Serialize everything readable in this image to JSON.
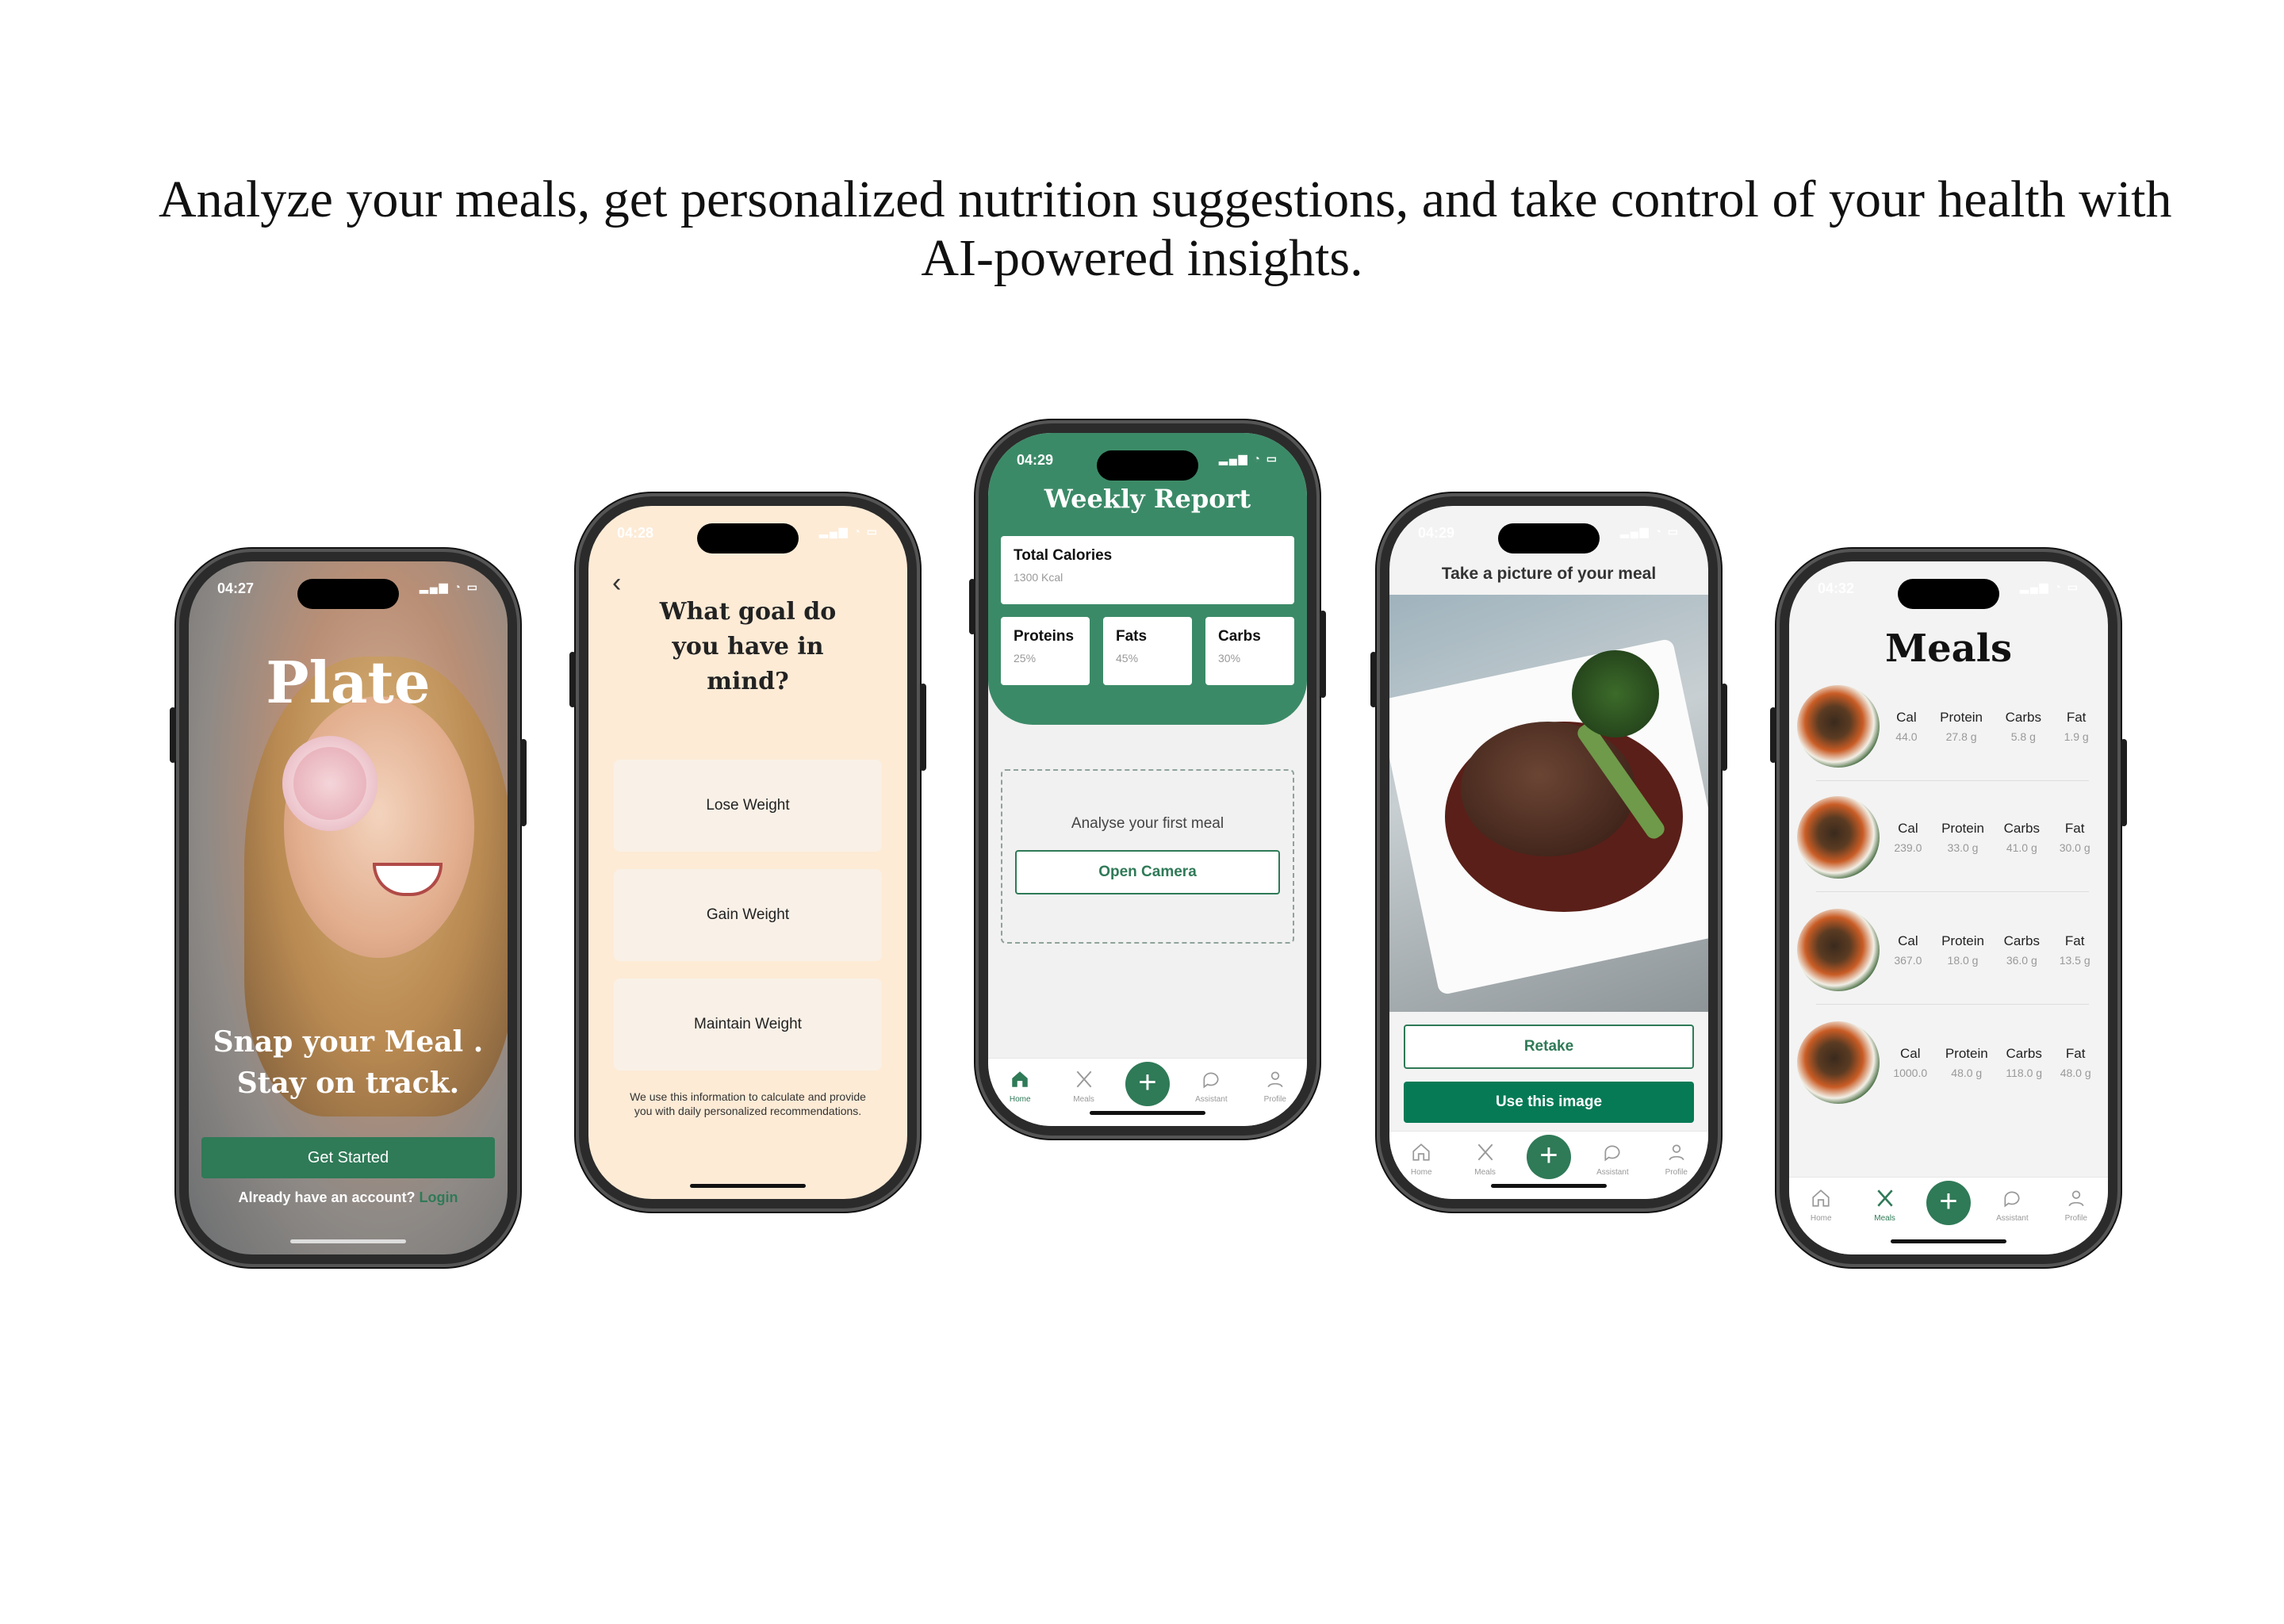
{
  "headline": {
    "line1": "Analyze your meals, get personalized nutrition suggestions, and take control of your health with",
    "line2": "AI-powered insights."
  },
  "accent_color": "#2f7a57",
  "tab_bar": {
    "home": "Home",
    "meals": "Meals",
    "assistant": "Assistant",
    "profile": "Profile",
    "add": "+"
  },
  "screen_welcome": {
    "time": "04:27",
    "app_name": "Plate",
    "tagline_line1": "Snap your Meal .",
    "tagline_line2": "Stay on track.",
    "cta": "Get Started",
    "login_prompt": "Already have an account?",
    "login_link": "Login"
  },
  "screen_goal": {
    "time": "04:28",
    "question_line1": "What goal do",
    "question_line2": "you have in",
    "question_line3": "mind?",
    "options": [
      "Lose Weight",
      "Gain Weight",
      "Maintain Weight"
    ],
    "note": "We use this information to calculate and provide you with daily personalized recommendations."
  },
  "screen_report": {
    "time": "04:29",
    "title": "Weekly Report",
    "total_calories_label": "Total Calories",
    "total_calories_value": "1300 Kcal",
    "macros": [
      {
        "label": "Proteins",
        "value": "25%"
      },
      {
        "label": "Fats",
        "value": "45%"
      },
      {
        "label": "Carbs",
        "value": "30%"
      }
    ],
    "analyse_prompt": "Analyse your first meal",
    "open_camera": "Open Camera"
  },
  "screen_camera": {
    "time": "04:29",
    "title": "Take a picture of your meal",
    "retake": "Retake",
    "use_image": "Use this image"
  },
  "screen_meals": {
    "time": "04:32",
    "title": "Meals",
    "headers": [
      "Cal",
      "Protein",
      "Carbs",
      "Fat"
    ],
    "meals": [
      {
        "cal": "44.0",
        "protein": "27.8 g",
        "carbs": "5.8 g",
        "fat": "1.9 g"
      },
      {
        "cal": "239.0",
        "protein": "33.0 g",
        "carbs": "41.0 g",
        "fat": "30.0 g"
      },
      {
        "cal": "367.0",
        "protein": "18.0 g",
        "carbs": "36.0 g",
        "fat": "13.5 g"
      },
      {
        "cal": "1000.0",
        "protein": "48.0 g",
        "carbs": "118.0 g",
        "fat": "48.0 g"
      }
    ]
  }
}
